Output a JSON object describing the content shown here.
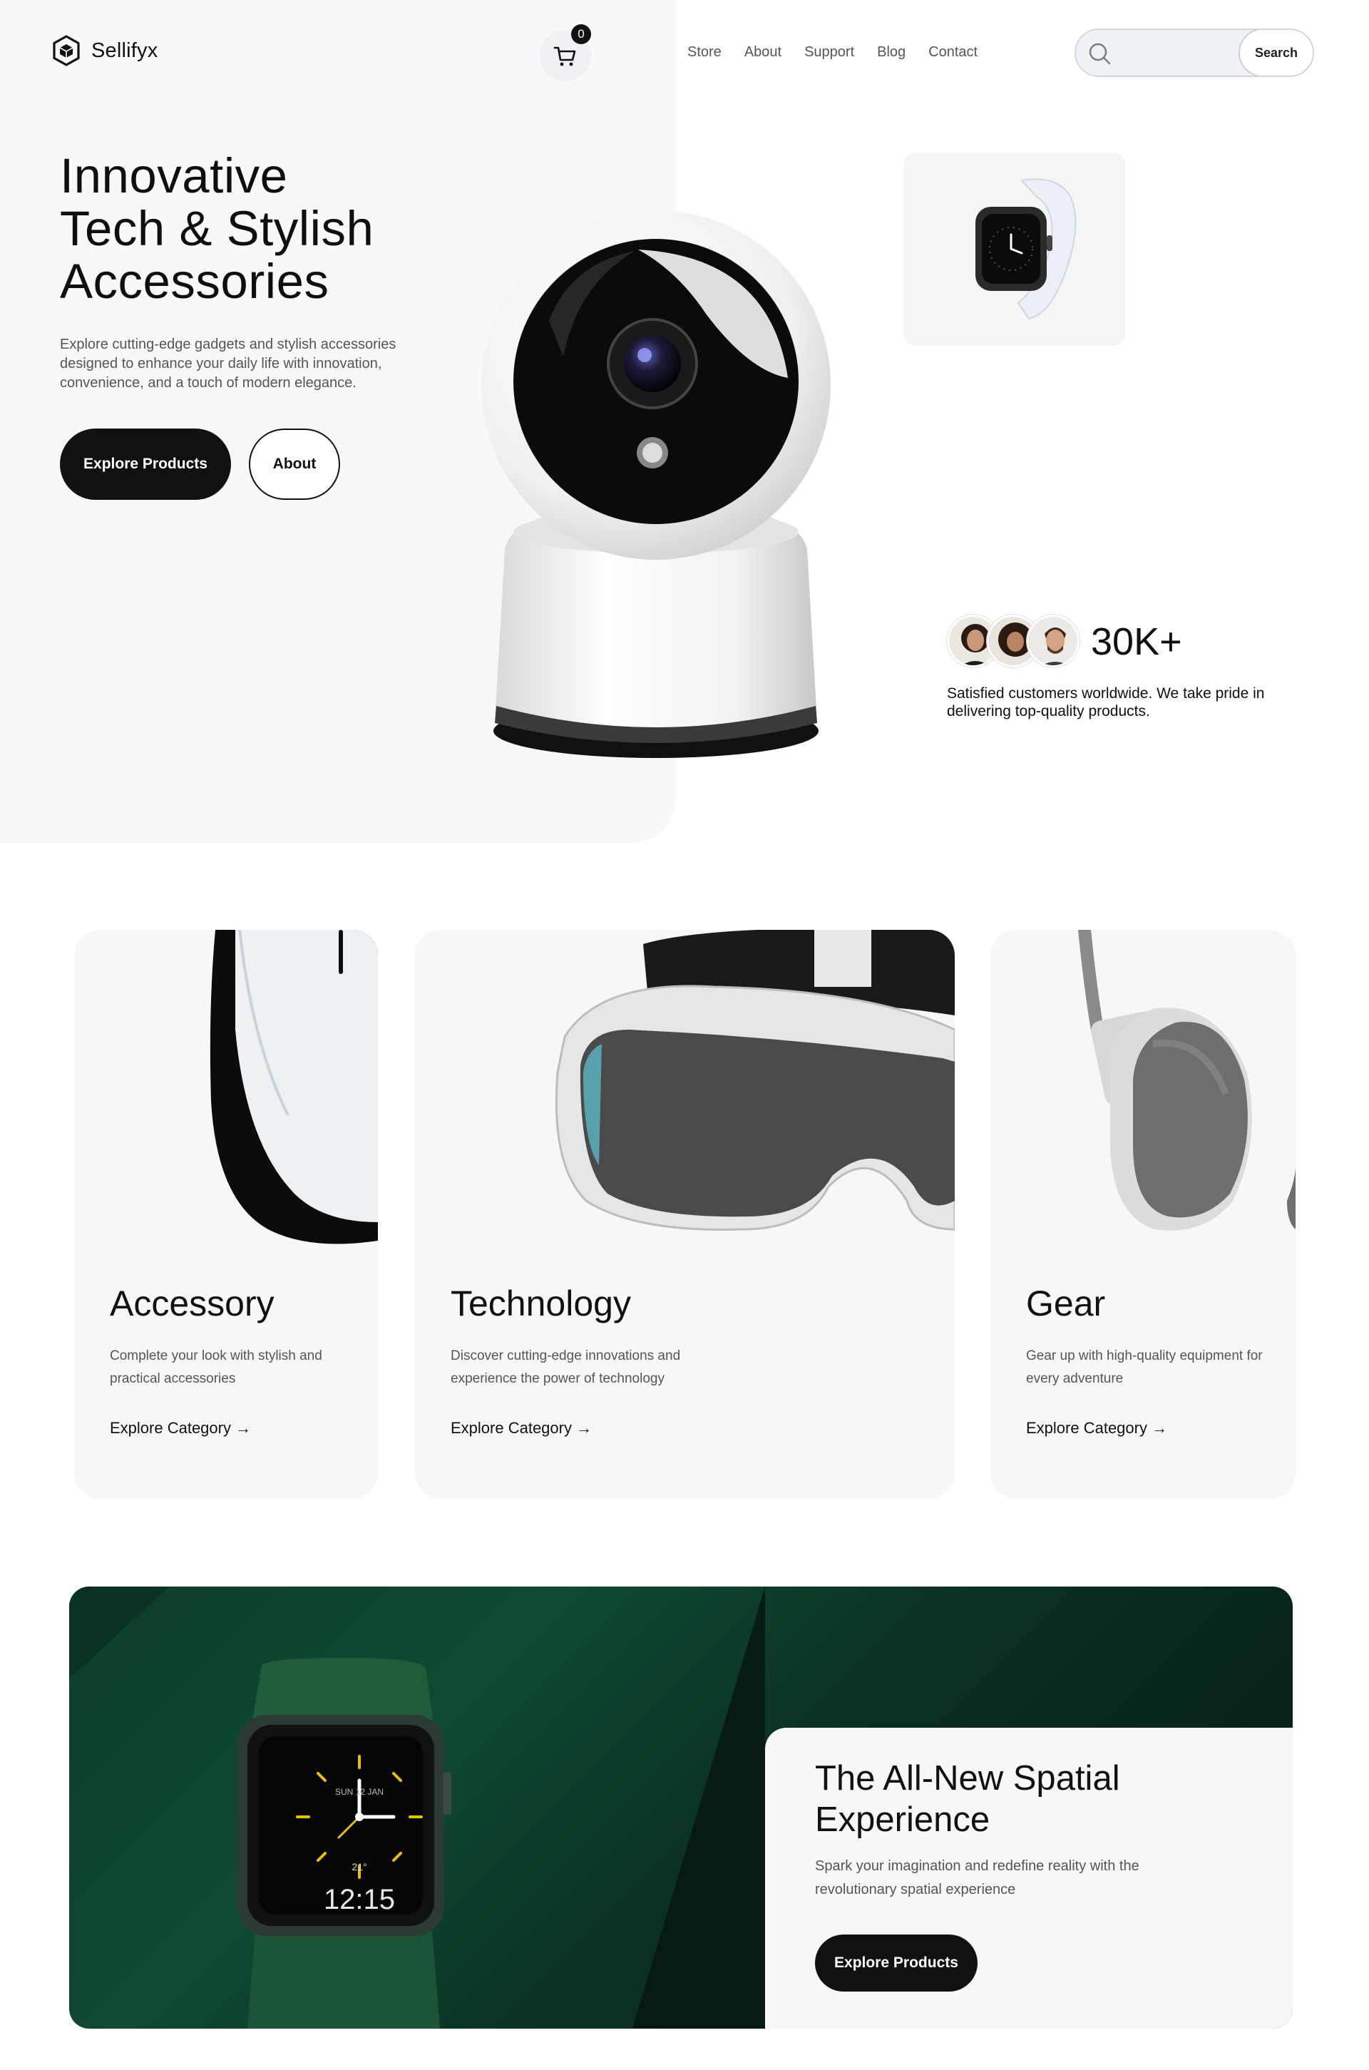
{
  "header": {
    "brand": "Sellifyx",
    "cart_count": "0",
    "nav": [
      "Store",
      "About",
      "Support",
      "Blog",
      "Contact"
    ],
    "search_placeholder": "",
    "search_button": "Search"
  },
  "hero": {
    "title_lines": [
      "Innovative",
      "Tech & Stylish",
      "Accessories"
    ],
    "description": "Explore cutting-edge gadgets and stylish accessories designed to enhance your daily life with innovation, convenience, and a touch of modern elegance.",
    "primary_button": "Explore Products",
    "secondary_button": "About",
    "stat_value": "30K+",
    "stat_description": "Satisfied customers worldwide. We take pride in delivering top-quality products."
  },
  "categories": [
    {
      "title": "Accessory",
      "description": "Complete your look with stylish and practical accessories",
      "link": "Explore Category →"
    },
    {
      "title": "Technology",
      "description": "Discover cutting-edge innovations and experience the power of technology",
      "link": "Explore Category →"
    },
    {
      "title": "Gear",
      "description": "Gear up with high-quality equipment for every adventure",
      "link": "Explore Category →"
    }
  ],
  "banner": {
    "title_lines": [
      "The All-New Spatial",
      "Experience"
    ],
    "description": "Spark your imagination and redefine reality with the revolutionary spatial experience",
    "button": "Explore Products",
    "watch_date": "SUN 12 JAN",
    "watch_temp": "21°",
    "watch_time": "12:15"
  },
  "colors": {
    "accent_dark": "#111111",
    "hero_bg": "#f8f8f8",
    "banner_green": "#0f4a32",
    "watch_hands": "#e8c200"
  },
  "icons": [
    "cube-logo-icon",
    "cart-icon",
    "search-icon"
  ]
}
